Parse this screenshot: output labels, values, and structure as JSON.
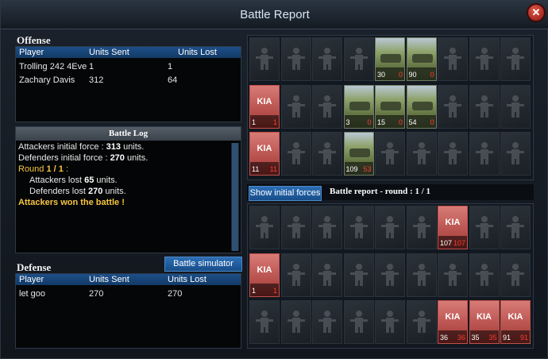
{
  "window": {
    "title": "Battle Report"
  },
  "offense": {
    "title": "Offense",
    "columns": [
      "Player",
      "Units Sent",
      "Units Lost"
    ],
    "rows": [
      {
        "player": "Trolling 242 4Eve",
        "sent": "1",
        "lost": "1"
      },
      {
        "player": "Zachary Davis",
        "sent": "312",
        "lost": "64"
      }
    ]
  },
  "battle_log": {
    "title": "Battle Log",
    "attackers_initial_prefix": "Attackers initial force : ",
    "attackers_initial_value": "313",
    "attackers_initial_suffix": " units.",
    "defenders_initial_prefix": "Defenders initial force : ",
    "defenders_initial_value": "270",
    "defenders_initial_suffix": " units.",
    "round_prefix": "Round ",
    "round_value": "1 / 1",
    "round_suffix": " :",
    "attackers_lost_prefix": "Attackers lost ",
    "attackers_lost_value": "65",
    "attackers_lost_suffix": " units.",
    "defenders_lost_prefix": "Defenders lost ",
    "defenders_lost_value": "270",
    "defenders_lost_suffix": " units.",
    "result": "Attackers won the battle !"
  },
  "buttons": {
    "battle_simulator": "Battle simulator",
    "show_initial_forces": "Show initial forces"
  },
  "defense": {
    "title": "Defense",
    "columns": [
      "Player",
      "Units Sent",
      "Units Lost"
    ],
    "rows": [
      {
        "player": "let goo",
        "sent": "270",
        "lost": "270"
      }
    ]
  },
  "round_label": "Battle report - round : 1 / 1",
  "kia_text": "KIA",
  "offense_grid": [
    [
      {
        "t": "empty"
      },
      {
        "t": "empty"
      },
      {
        "t": "empty"
      },
      {
        "t": "empty"
      },
      {
        "t": "unit",
        "count": "30",
        "lost": "0"
      },
      {
        "t": "unit",
        "count": "90",
        "lost": "0"
      },
      {
        "t": "empty"
      },
      {
        "t": "empty"
      },
      {
        "t": "empty"
      }
    ],
    [
      {
        "t": "kia",
        "count": "1",
        "lost": "1"
      },
      {
        "t": "empty"
      },
      {
        "t": "empty"
      },
      {
        "t": "unit",
        "count": "3",
        "lost": "0"
      },
      {
        "t": "unit",
        "count": "15",
        "lost": "0"
      },
      {
        "t": "unit",
        "count": "54",
        "lost": "0"
      },
      {
        "t": "empty"
      },
      {
        "t": "empty"
      },
      {
        "t": "empty"
      }
    ],
    [
      {
        "t": "kia",
        "count": "11",
        "lost": "11"
      },
      {
        "t": "empty"
      },
      {
        "t": "empty"
      },
      {
        "t": "unit",
        "count": "109",
        "lost": "53"
      },
      {
        "t": "empty"
      },
      {
        "t": "empty"
      },
      {
        "t": "empty"
      },
      {
        "t": "empty"
      },
      {
        "t": "empty"
      }
    ]
  ],
  "defense_grid": [
    [
      {
        "t": "empty"
      },
      {
        "t": "empty"
      },
      {
        "t": "empty"
      },
      {
        "t": "empty"
      },
      {
        "t": "empty"
      },
      {
        "t": "empty"
      },
      {
        "t": "kia",
        "count": "107",
        "lost": "107"
      },
      {
        "t": "empty"
      },
      {
        "t": "empty"
      }
    ],
    [
      {
        "t": "kia",
        "count": "1",
        "lost": "1"
      },
      {
        "t": "empty"
      },
      {
        "t": "empty"
      },
      {
        "t": "empty"
      },
      {
        "t": "empty"
      },
      {
        "t": "empty"
      },
      {
        "t": "empty"
      },
      {
        "t": "empty"
      },
      {
        "t": "empty"
      }
    ],
    [
      {
        "t": "empty"
      },
      {
        "t": "empty"
      },
      {
        "t": "empty"
      },
      {
        "t": "empty"
      },
      {
        "t": "empty"
      },
      {
        "t": "empty"
      },
      {
        "t": "kia",
        "count": "36",
        "lost": "36"
      },
      {
        "t": "kia",
        "count": "35",
        "lost": "35"
      },
      {
        "t": "kia",
        "count": "91",
        "lost": "91"
      }
    ]
  ]
}
